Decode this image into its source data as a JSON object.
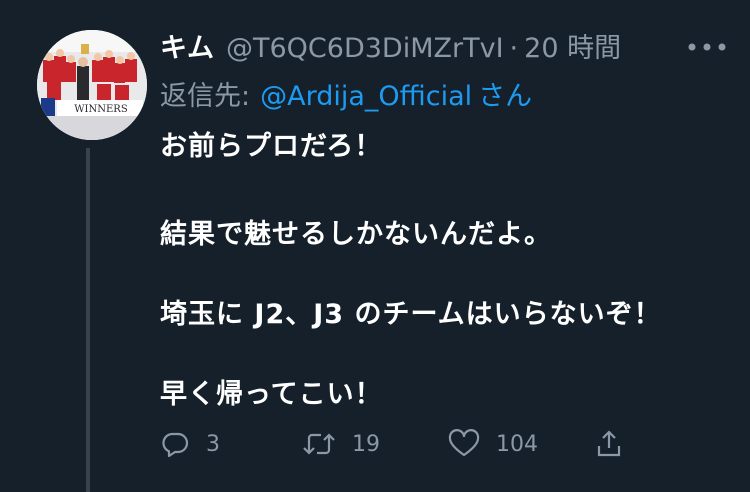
{
  "tweet": {
    "display_name": "キム",
    "handle": "@T6QC6D3DiMZrTvI",
    "separator": "·",
    "time": "20 時間",
    "reply_prefix": "返信先:",
    "reply_mention": "@Ardija_Official",
    "reply_suffix": "さん",
    "body_lines": [
      "お前らプロだろ！",
      "結果で魅せるしかないんだよ。",
      "埼玉に J2、J3 のチームはいらないぞ！",
      "早く帰ってこい！"
    ],
    "avatar_text": "WINNERS"
  },
  "actions": {
    "reply": {
      "icon": "reply-icon",
      "count": "3"
    },
    "retweet": {
      "icon": "retweet-icon",
      "count": "19"
    },
    "like": {
      "icon": "heart-icon",
      "count": "104"
    },
    "share": {
      "icon": "share-icon"
    }
  },
  "colors": {
    "background": "#15202b",
    "secondary_text": "#8b98a5",
    "link": "#1d9bf0",
    "thread_line": "#38444d"
  }
}
